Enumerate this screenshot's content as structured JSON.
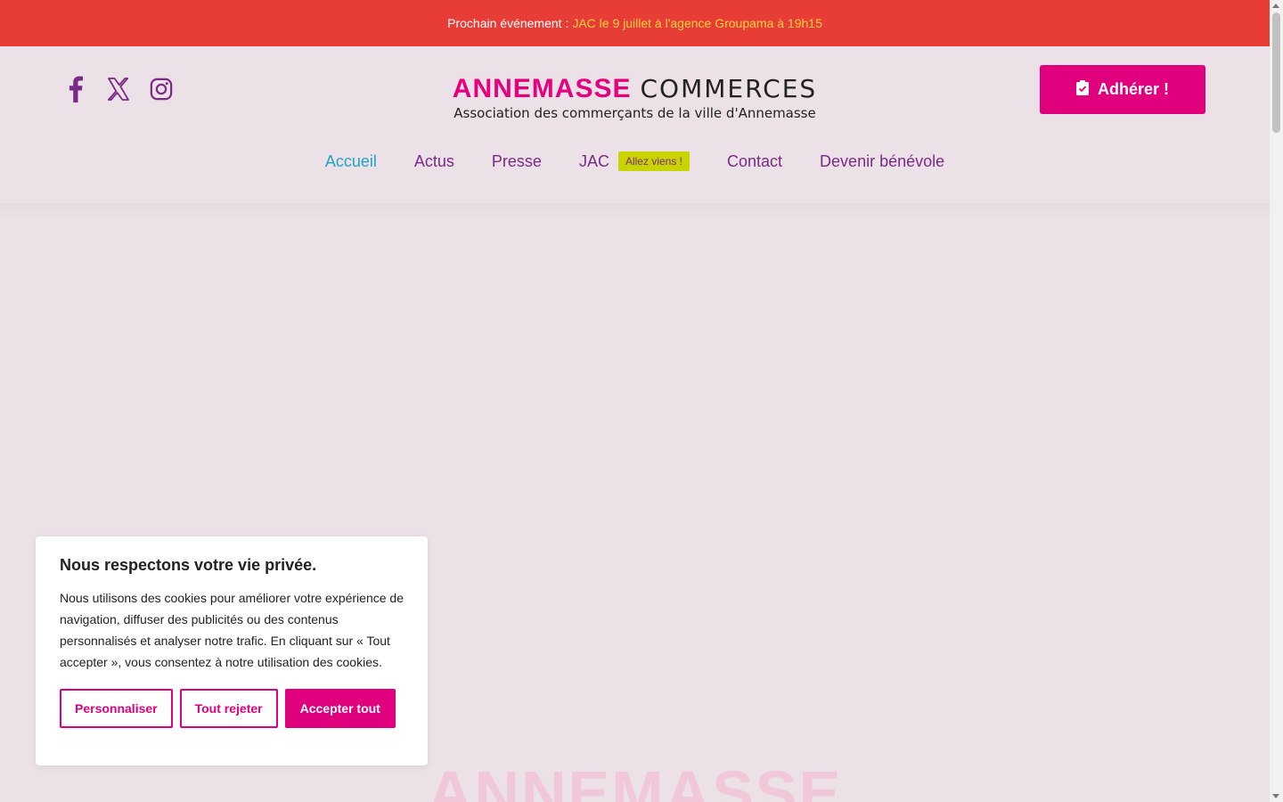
{
  "announcement": {
    "label": "Prochain événement :",
    "event": "JAC le 9 juillet à l'agence Groupama à 19h15"
  },
  "social": [
    {
      "icon": "facebook-icon"
    },
    {
      "icon": "x-twitter-icon"
    },
    {
      "icon": "instagram-icon"
    }
  ],
  "logo": {
    "part1": "ANNEMASSE",
    "part2": "COMMERCES",
    "tagline": "Association des commerçants de la ville d'Annemasse"
  },
  "cta": {
    "label": "Adhérer !",
    "icon": "clipboard-check-icon"
  },
  "nav": {
    "items": [
      "Accueil",
      "Actus",
      "Presse",
      "JAC",
      "Contact",
      "Devenir bénévole"
    ],
    "badge": "Allez viens !",
    "active": "Accueil"
  },
  "watermark": "ANNEMASSE",
  "cookie": {
    "title": "Nous respectons votre vie privée.",
    "text": "Nous utilisons des cookies pour améliorer votre expérience de navigation, diffuser des publicités ou des contenus personnalisés et analyser notre trafic. En cliquant sur « Tout accepter », vous consentez à notre utilisation des cookies.",
    "customize": "Personnaliser",
    "reject": "Tout rejeter",
    "accept": "Accepter tout"
  },
  "colors": {
    "accent": "#e0007d",
    "topbar": "#e83d37",
    "nav": "#7a2a86",
    "nav_active": "#1fa6c0",
    "badge": "#c8d400"
  }
}
